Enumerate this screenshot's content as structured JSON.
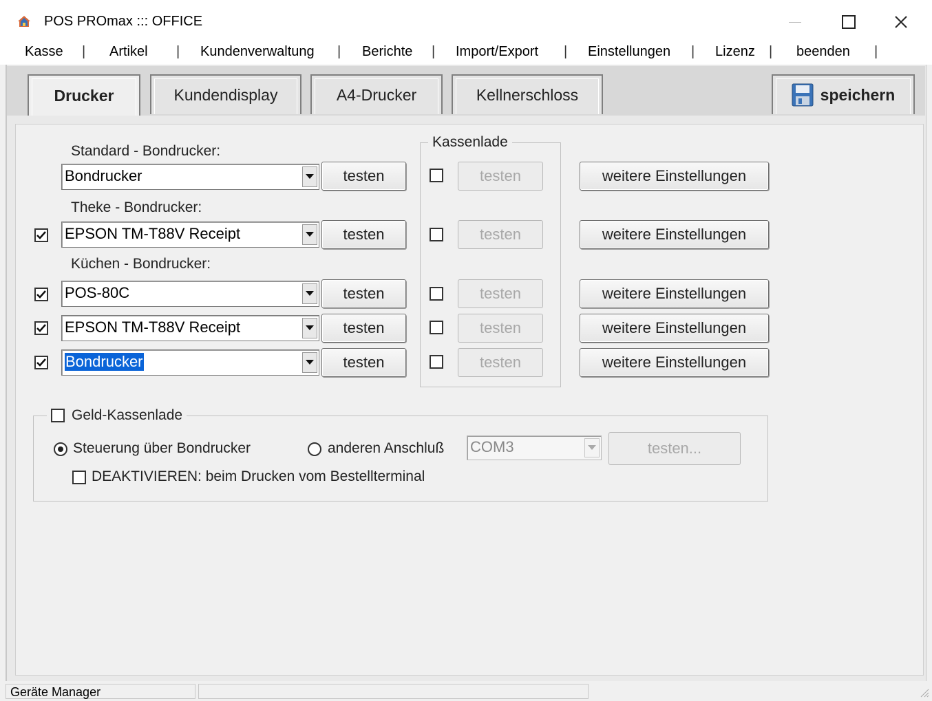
{
  "window": {
    "title": "POS PROmax ::: OFFICE",
    "minimize_icon": "minimize-icon",
    "maximize_icon": "maximize-icon",
    "close_icon": "close-icon"
  },
  "menu": {
    "items": [
      "Kasse",
      "Artikel",
      "Kundenverwaltung",
      "Berichte",
      "Import/Export",
      "Einstellungen",
      "Lizenz",
      "beenden"
    ],
    "separator": "|"
  },
  "tabs": {
    "items": [
      "Drucker",
      "Kundendisplay",
      "A4-Drucker",
      "Kellnerschloss"
    ],
    "active": "Drucker",
    "save_label": "speichern",
    "save_icon": "floppy-disk-icon"
  },
  "printers": {
    "standard_label": "Standard - Bondrucker:",
    "theke_label": "Theke - Bondrucker:",
    "kuechen_label": "Küchen - Bondrucker:",
    "test_label": "testen",
    "more_settings_label": "weitere Einstellungen",
    "rows": [
      {
        "printer": "Bondrucker",
        "enabled": null,
        "drawer": false
      },
      {
        "printer": "EPSON TM-T88V Receipt",
        "enabled": true,
        "drawer": false
      },
      {
        "printer": "POS-80C",
        "enabled": true,
        "drawer": false
      },
      {
        "printer": "EPSON TM-T88V Receipt",
        "enabled": true,
        "drawer": false
      },
      {
        "printer": "Bondrucker",
        "enabled": true,
        "drawer": false,
        "selected": true
      }
    ]
  },
  "kassenlade": {
    "group_label": "Kassenlade"
  },
  "geld_kassenlade": {
    "label": "Geld-Kassenlade",
    "checked": false,
    "radio_bondrucker": "Steuerung über Bondrucker",
    "radio_bondrucker_selected": true,
    "radio_anschluss": "anderen Anschluß",
    "port_value": "COM3",
    "test_button": "testen...",
    "deactivate_label": "DEAKTIVIEREN: beim Drucken vom Bestellterminal",
    "deactivate_checked": false
  },
  "status": {
    "left": "Geräte Manager",
    "middle": ""
  }
}
